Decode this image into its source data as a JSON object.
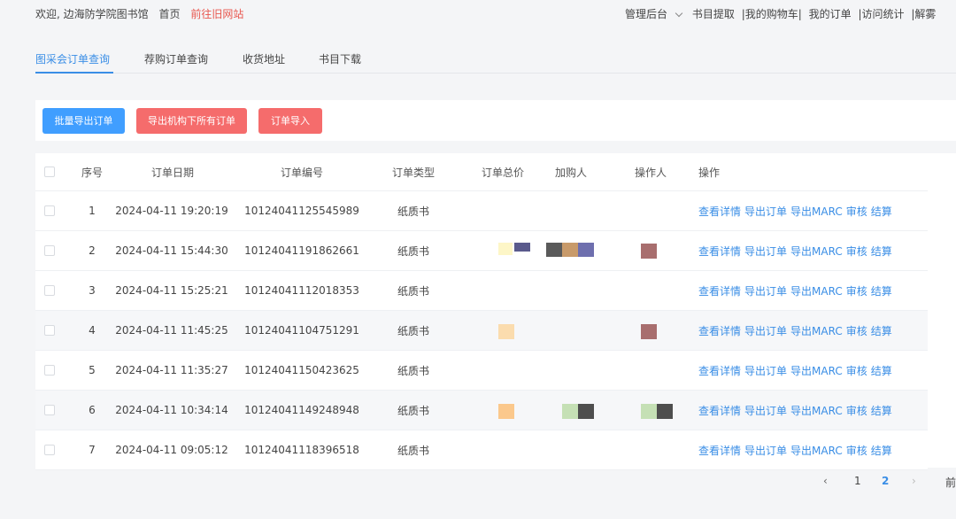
{
  "topbar": {
    "welcome": "欢迎, 边海防学院图书馆",
    "home": "首页",
    "old_site": "前往旧网站",
    "admin": "管理后台",
    "links": [
      "书目提取",
      "|我的购物车|",
      "我的订单",
      "|访问统计",
      "|解雾"
    ]
  },
  "tabs": [
    "图采会订单查询",
    "荐购订单查询",
    "收货地址",
    "书目下载"
  ],
  "toolbar": {
    "batch_export": "批量导出订单",
    "export_all": "导出机构下所有订单",
    "import": "订单导入"
  },
  "table": {
    "headers": [
      "序号",
      "订单日期",
      "订单编号",
      "订单类型",
      "订单总价",
      "加购人",
      "操作人",
      "操作"
    ],
    "actions": [
      "查看详情",
      "导出订单",
      "导出MARC",
      "审核",
      "结算"
    ],
    "rows": [
      {
        "no": "1",
        "date": "2024-04-11 19:20:19",
        "order_no": "10124041125545989",
        "type": "纸质书"
      },
      {
        "no": "2",
        "date": "2024-04-11 15:44:30",
        "order_no": "10124041191862661",
        "type": "纸质书"
      },
      {
        "no": "3",
        "date": "2024-04-11 15:25:21",
        "order_no": "10124041112018353",
        "type": "纸质书"
      },
      {
        "no": "4",
        "date": "2024-04-11 11:45:25",
        "order_no": "10124041104751291",
        "type": "纸质书"
      },
      {
        "no": "5",
        "date": "2024-04-11 11:35:27",
        "order_no": "10124041150423625",
        "type": "纸质书"
      },
      {
        "no": "6",
        "date": "2024-04-11 10:34:14",
        "order_no": "10124041149248948",
        "type": "纸质书"
      },
      {
        "no": "7",
        "date": "2024-04-11 09:05:12",
        "order_no": "10124041118396518",
        "type": "纸质书"
      }
    ]
  },
  "pagination": {
    "prev": "‹",
    "page1": "1",
    "page2": "2",
    "next": "›",
    "goto": "前"
  },
  "colors": {
    "accent": "#3a8ee6",
    "danger": "#f56c6c",
    "primary_button": "#409eff"
  }
}
